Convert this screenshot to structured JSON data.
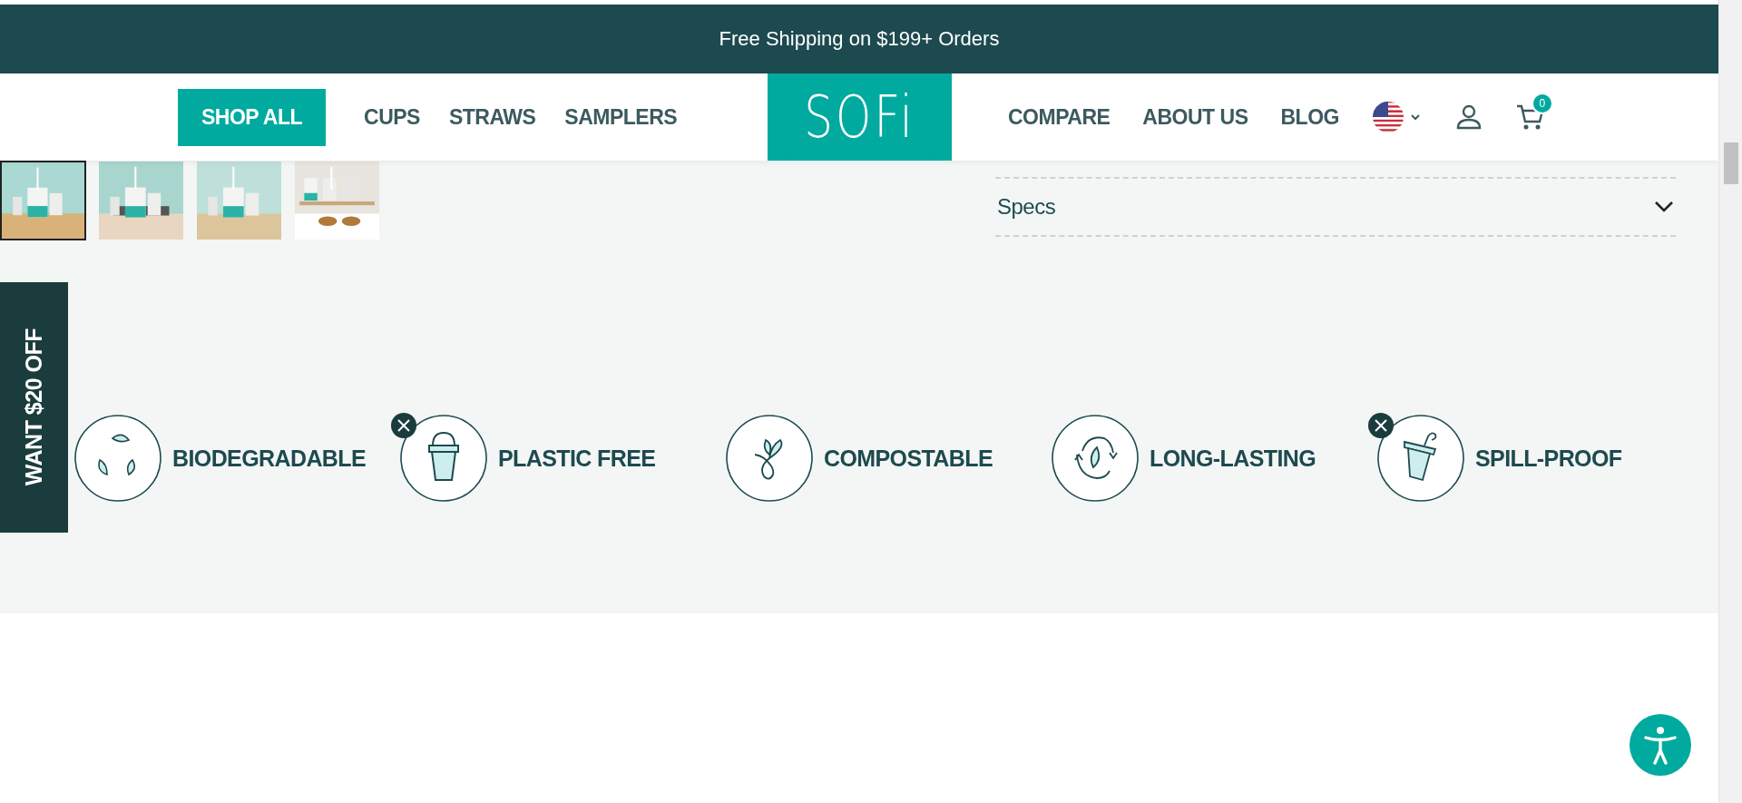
{
  "announcement": "Free Shipping on $199+ Orders",
  "nav_left": [
    {
      "label": "SHOP ALL",
      "highlighted": true
    },
    {
      "label": "CUPS",
      "highlighted": false
    },
    {
      "label": "STRAWS",
      "highlighted": false
    },
    {
      "label": "SAMPLERS",
      "highlighted": false
    }
  ],
  "logo": "SOFi",
  "nav_right": [
    {
      "label": "COMPARE"
    },
    {
      "label": "ABOUT US"
    },
    {
      "label": "BLOG"
    }
  ],
  "cart_count": "0",
  "thumbnails": [
    {
      "kind": "picture",
      "selected": true
    },
    {
      "kind": "picture",
      "selected": false
    },
    {
      "kind": "picture",
      "selected": false
    },
    {
      "kind": "picture",
      "selected": false
    }
  ],
  "accordion": [
    {
      "label": "Specs",
      "expanded": false
    }
  ],
  "promo_tab": "WANT $20 OFF",
  "features": [
    {
      "label": "BIODEGRADABLE",
      "kind": "recycle",
      "crossed": false
    },
    {
      "label": "PLASTIC FREE",
      "kind": "cup",
      "crossed": true
    },
    {
      "label": "COMPOSTABLE",
      "kind": "sprout",
      "crossed": false
    },
    {
      "label": "LONG-LASTING",
      "kind": "cycle",
      "crossed": false
    },
    {
      "label": "SPILL-PROOF",
      "kind": "straw-cup",
      "crossed": true
    }
  ]
}
